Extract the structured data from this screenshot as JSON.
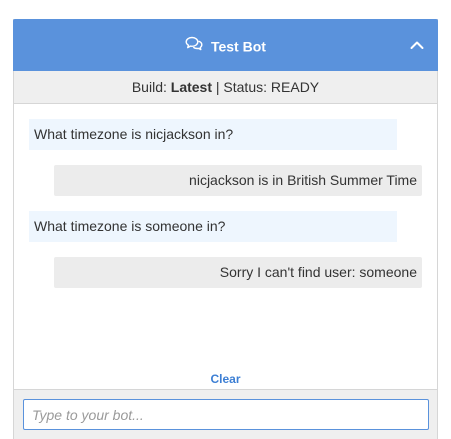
{
  "header": {
    "title": "Test Bot",
    "chat_icon": "chat-bubbles-icon",
    "collapse_icon": "chevron-up-icon",
    "color": "#5a92dc"
  },
  "status": {
    "build_label": "Build:",
    "build_value": "Latest",
    "separator": "|",
    "status_label": "Status:",
    "status_value": "READY"
  },
  "messages": [
    {
      "from": "user",
      "text": "What timezone is nicjackson in?"
    },
    {
      "from": "bot",
      "text": "nicjackson is in British Summer Time"
    },
    {
      "from": "user",
      "text": "What timezone is someone in?"
    },
    {
      "from": "bot",
      "text": "Sorry I can't find user: someone"
    }
  ],
  "clear_label": "Clear",
  "input": {
    "value": "",
    "placeholder": "Type to your bot..."
  }
}
